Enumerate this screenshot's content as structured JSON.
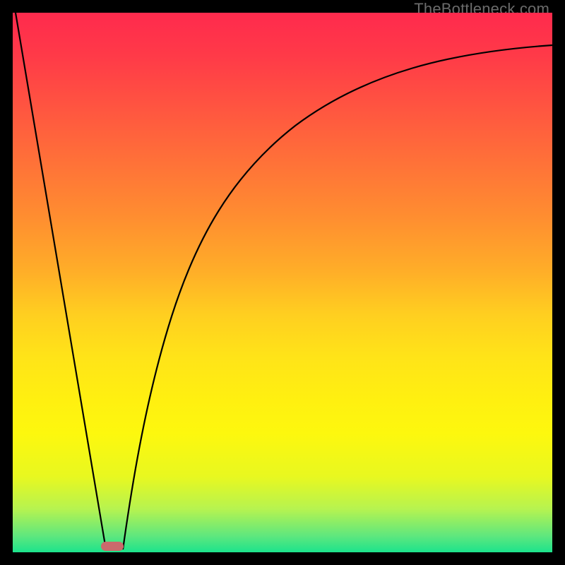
{
  "watermark": "TheBottleneck.com",
  "colors": {
    "black": "#000000",
    "gradient_top": "#ff2a4d",
    "gradient_bottom": "#1ce38c",
    "curve": "#000000",
    "marker": "#cb6a6c",
    "watermark": "#6b6b6b"
  },
  "chart_data": {
    "type": "line",
    "title": "",
    "xlabel": "",
    "ylabel": "",
    "xlim": [
      0,
      100
    ],
    "ylim": [
      0,
      100
    ],
    "grid": false,
    "legend": false,
    "series": [
      {
        "name": "left-line",
        "x": [
          0,
          17
        ],
        "values": [
          100,
          0
        ]
      },
      {
        "name": "right-curve",
        "x": [
          20,
          24,
          28,
          34,
          42,
          52,
          64,
          78,
          92,
          100
        ],
        "values": [
          0,
          20,
          38,
          55,
          70,
          80,
          87,
          91,
          93,
          94
        ]
      }
    ],
    "marker": {
      "x": 17.5,
      "y": 0
    },
    "background_gradient": {
      "orientation": "vertical",
      "stops": [
        {
          "pos": 0,
          "color": "#ff2a4d"
        },
        {
          "pos": 0.5,
          "color": "#ffcf20"
        },
        {
          "pos": 0.8,
          "color": "#fdf80e"
        },
        {
          "pos": 1.0,
          "color": "#1ce38c"
        }
      ]
    }
  }
}
